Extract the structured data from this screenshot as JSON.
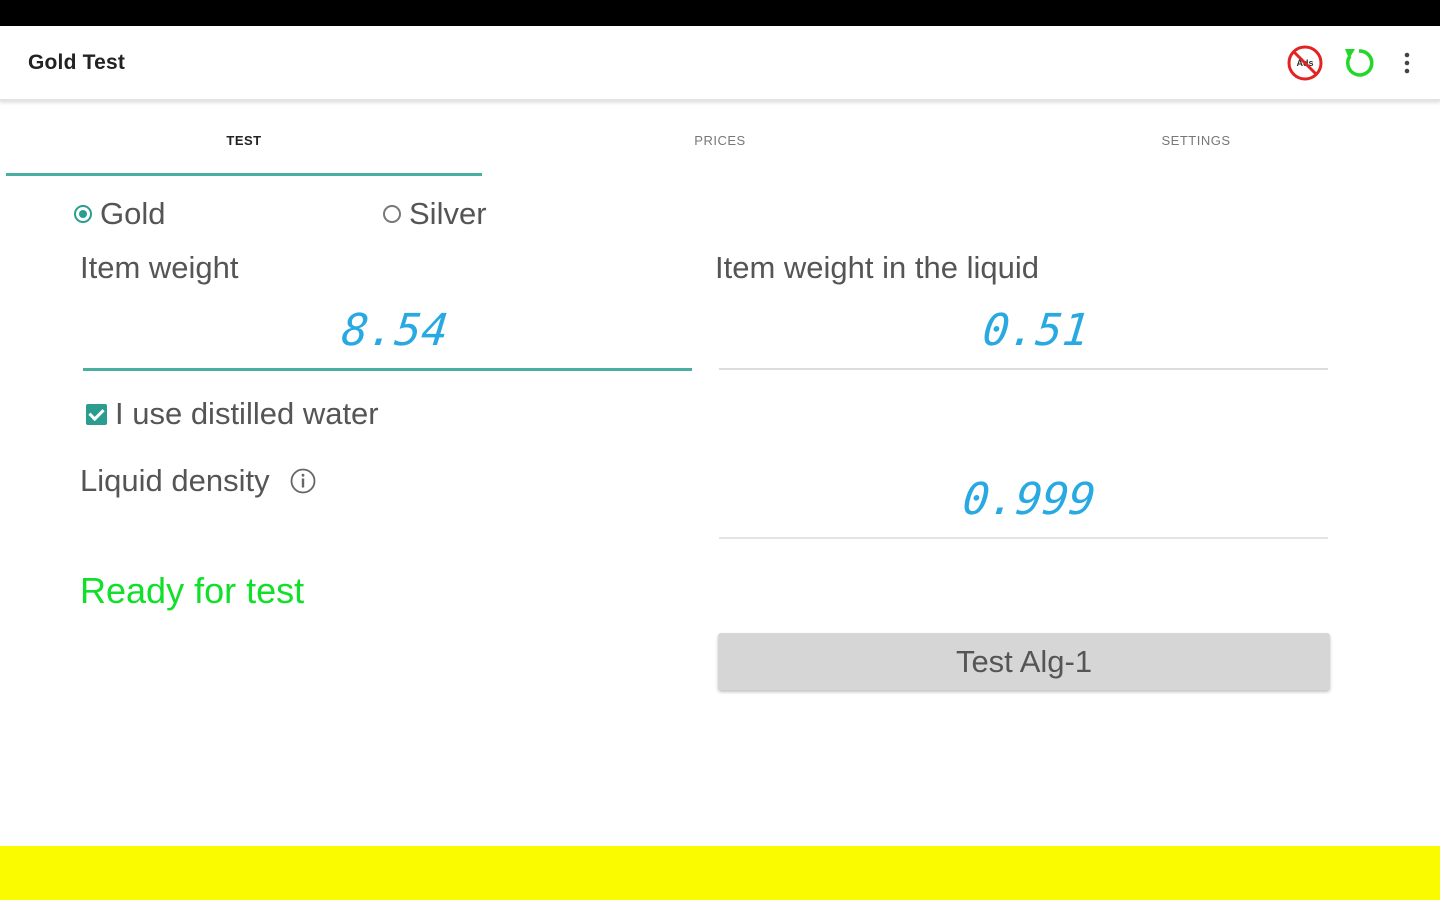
{
  "app": {
    "title": "Gold Test"
  },
  "toolbar": {
    "ads_icon": "no-ads-icon",
    "refresh_icon": "refresh-icon",
    "more_icon": "more-vert-icon"
  },
  "tabs": [
    {
      "label": "TEST",
      "active": true
    },
    {
      "label": "PRICES",
      "active": false
    },
    {
      "label": "SETTINGS",
      "active": false
    }
  ],
  "metal": {
    "options": [
      {
        "label": "Gold",
        "checked": true
      },
      {
        "label": "Silver",
        "checked": false
      }
    ]
  },
  "fields": {
    "item_weight": {
      "label": "Item weight",
      "value": "8.54"
    },
    "item_weight_liquid": {
      "label": "Item weight in the liquid",
      "value": "0.51"
    },
    "liquid_density": {
      "label": "Liquid density",
      "value": "0.999"
    }
  },
  "distilled": {
    "label": "I use distilled water",
    "checked": true
  },
  "status": {
    "text": "Ready for test"
  },
  "test_button": {
    "label": "Test Alg-1"
  },
  "colors": {
    "accent": "#2a9d8f",
    "tab_indicator": "#4aaea1",
    "digital_value": "#29a9e1",
    "status_green": "#11e02a",
    "banner_yellow": "#fbfb00"
  }
}
